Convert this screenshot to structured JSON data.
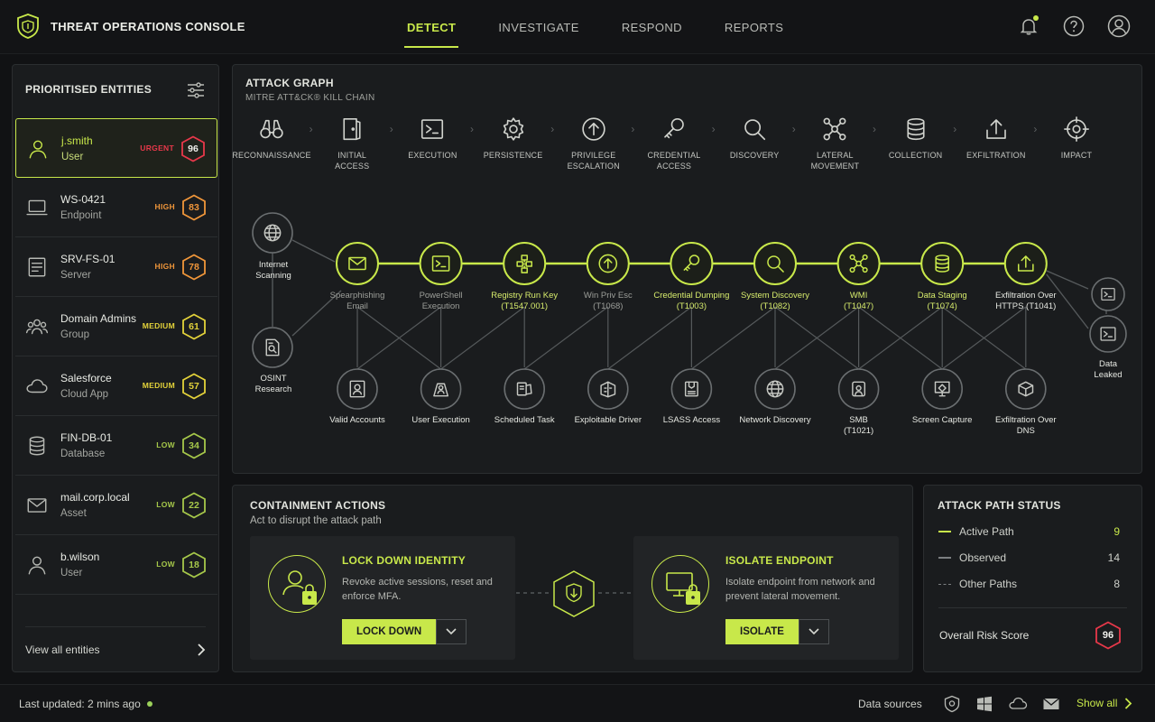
{
  "app": {
    "title": "THREAT OPERATIONS CONSOLE"
  },
  "nav": {
    "tabs": [
      {
        "label": "DETECT",
        "active": true
      },
      {
        "label": "INVESTIGATE",
        "active": false
      },
      {
        "label": "RESPOND",
        "active": false
      },
      {
        "label": "REPORTS",
        "active": false
      }
    ]
  },
  "top_icons": [
    "bell-icon",
    "help-icon",
    "user-icon"
  ],
  "colors": {
    "accent": "#c8e84a",
    "urgent": "#e8384a",
    "high": "#f0963a",
    "medium": "#e3d23a",
    "low": "#a6c84a"
  },
  "entities": {
    "title": "PRIORITISED ENTITIES",
    "view_all": "View all entities",
    "items": [
      {
        "name": "j.smith",
        "type": "User",
        "severity": "URGENT",
        "score": "96",
        "icon": "user-icon"
      },
      {
        "name": "WS-0421",
        "type": "Endpoint",
        "severity": "HIGH",
        "score": "83",
        "icon": "laptop-icon"
      },
      {
        "name": "SRV-FS-01",
        "type": "Server",
        "severity": "HIGH",
        "score": "78",
        "icon": "server-icon"
      },
      {
        "name": "Domain Admins",
        "type": "Group",
        "severity": "MEDIUM",
        "score": "61",
        "icon": "group-icon"
      },
      {
        "name": "Salesforce",
        "type": "Cloud App",
        "severity": "MEDIUM",
        "score": "57",
        "icon": "cloud-icon"
      },
      {
        "name": "FIN-DB-01",
        "type": "Database",
        "severity": "LOW",
        "score": "34",
        "icon": "database-icon"
      },
      {
        "name": "mail.corp.local",
        "type": "Asset",
        "severity": "LOW",
        "score": "22",
        "icon": "mail-icon"
      },
      {
        "name": "b.wilson",
        "type": "User",
        "severity": "LOW",
        "score": "18",
        "icon": "user-icon"
      }
    ]
  },
  "graph": {
    "title": "ATTACK GRAPH",
    "subtitle": "MITRE ATT&CK® KILL CHAIN",
    "tactics": [
      {
        "label": "RECONNAISSANCE",
        "icon": "binoculars-icon"
      },
      {
        "label": "INITIAL\nACCESS",
        "icon": "door-icon"
      },
      {
        "label": "EXECUTION",
        "icon": "terminal-icon"
      },
      {
        "label": "PERSISTENCE",
        "icon": "gear-icon"
      },
      {
        "label": "PRIVILEGE\nESCALATION",
        "icon": "arrow-up-icon"
      },
      {
        "label": "CREDENTIAL\nACCESS",
        "icon": "key-icon"
      },
      {
        "label": "DISCOVERY",
        "icon": "search-icon"
      },
      {
        "label": "LATERAL\nMOVEMENT",
        "icon": "network-icon"
      },
      {
        "label": "COLLECTION",
        "icon": "database-icon"
      },
      {
        "label": "EXFILTRATION",
        "icon": "upload-icon"
      },
      {
        "label": "IMPACT",
        "icon": "target-icon"
      }
    ],
    "nodes": {
      "internet": "Internet\nScanning",
      "osint": "OSINT\nResearch",
      "leaked": "Data\nLeaked",
      "main": [
        {
          "label": "Spearphishing\nEmail",
          "icon": "mail-icon",
          "style": "dim"
        },
        {
          "label": "PowerShell\nExecution",
          "icon": "terminal-icon",
          "style": "dim"
        },
        {
          "label": "Registry Run Key\n(T1547.001)",
          "icon": "registry-icon",
          "style": "hi"
        },
        {
          "label": "Win Priv Esc\n(T1068)",
          "icon": "arrow-up-icon",
          "style": "dim"
        },
        {
          "label": "Credential Dumping\n(T1003)",
          "icon": "key-icon",
          "style": "hi"
        },
        {
          "label": "System Discovery\n(T1082)",
          "icon": "search-icon",
          "style": "hi"
        },
        {
          "label": "WMI\n(T1047)",
          "icon": "network-icon",
          "style": "hi"
        },
        {
          "label": "Data Staging\n(T1074)",
          "icon": "database-icon",
          "style": "hi"
        },
        {
          "label": "Exfiltration Over\nHTTPS (T1041)",
          "icon": "upload-icon",
          "style": "wh"
        }
      ],
      "sub": [
        {
          "label": "Valid Accounts",
          "icon": "id-icon"
        },
        {
          "label": "User Execution",
          "icon": "user-exec-icon"
        },
        {
          "label": "Scheduled Task",
          "icon": "task-icon"
        },
        {
          "label": "Exploitable Driver",
          "icon": "driver-icon"
        },
        {
          "label": "LSASS Access",
          "icon": "lsass-icon"
        },
        {
          "label": "Network Discovery",
          "icon": "globe-icon"
        },
        {
          "label": "SMB\n(T1021)",
          "icon": "share-icon"
        },
        {
          "label": "Screen Capture",
          "icon": "screen-icon"
        },
        {
          "label": "Exfiltration Over\nDNS",
          "icon": "dns-icon"
        }
      ]
    }
  },
  "containment": {
    "title": "CONTAINMENT ACTIONS",
    "subtitle": "Act to disrupt the attack path",
    "actions": [
      {
        "title": "LOCK DOWN IDENTITY",
        "desc": "Revoke active sessions, reset and enforce MFA.",
        "button": "LOCK DOWN",
        "icon": "user-lock-icon"
      },
      {
        "title": "ISOLATE ENDPOINT",
        "desc": "Isolate endpoint from network and prevent lateral movement.",
        "button": "ISOLATE",
        "icon": "monitor-lock-icon"
      }
    ]
  },
  "status": {
    "title": "ATTACK PATH STATUS",
    "rows": [
      {
        "label": "Active Path",
        "value": "9",
        "style": "active"
      },
      {
        "label": "Observed",
        "value": "14",
        "style": "observed"
      },
      {
        "label": "Other Paths",
        "value": "8",
        "style": "other"
      }
    ],
    "risk_label": "Overall Risk Score",
    "risk_score": "96"
  },
  "footer": {
    "last_updated": "Last updated: 2 mins ago",
    "data_sources": "Data sources",
    "source_icons": [
      "shield-icon",
      "windows-icon",
      "cloud-icon",
      "mail-icon"
    ],
    "show_all": "Show all"
  }
}
